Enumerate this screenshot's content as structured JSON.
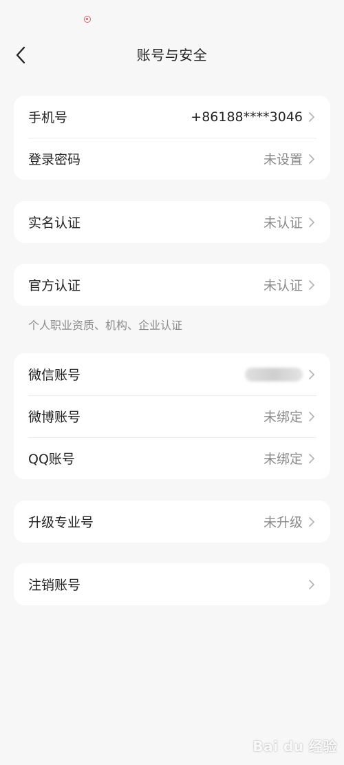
{
  "header": {
    "title": "账号与安全"
  },
  "groups": [
    {
      "rows": [
        {
          "label": "手机号",
          "value": "+86188****3046"
        },
        {
          "label": "登录密码",
          "value": "未设置"
        }
      ]
    },
    {
      "rows": [
        {
          "label": "实名认证",
          "value": "未认证"
        }
      ]
    },
    {
      "rows": [
        {
          "label": "官方认证",
          "value": "未认证"
        }
      ],
      "note": "个人职业资质、机构、企业认证"
    },
    {
      "rows": [
        {
          "label": "微信账号",
          "value": ""
        },
        {
          "label": "微博账号",
          "value": "未绑定"
        },
        {
          "label": "QQ账号",
          "value": "未绑定"
        }
      ]
    },
    {
      "rows": [
        {
          "label": "升级专业号",
          "value": "未升级"
        }
      ]
    },
    {
      "rows": [
        {
          "label": "注销账号",
          "value": ""
        }
      ]
    }
  ],
  "watermark": "Bai du 经验",
  "colors": {
    "background": "#f7f7f7",
    "card": "#ffffff",
    "text_primary": "#222222",
    "text_secondary": "#8a8a8a",
    "status_indicator": "#e05a62"
  },
  "icons": {
    "back": "chevron-left-icon",
    "row_arrow": "chevron-right-icon",
    "status": "recording-dot-icon"
  }
}
